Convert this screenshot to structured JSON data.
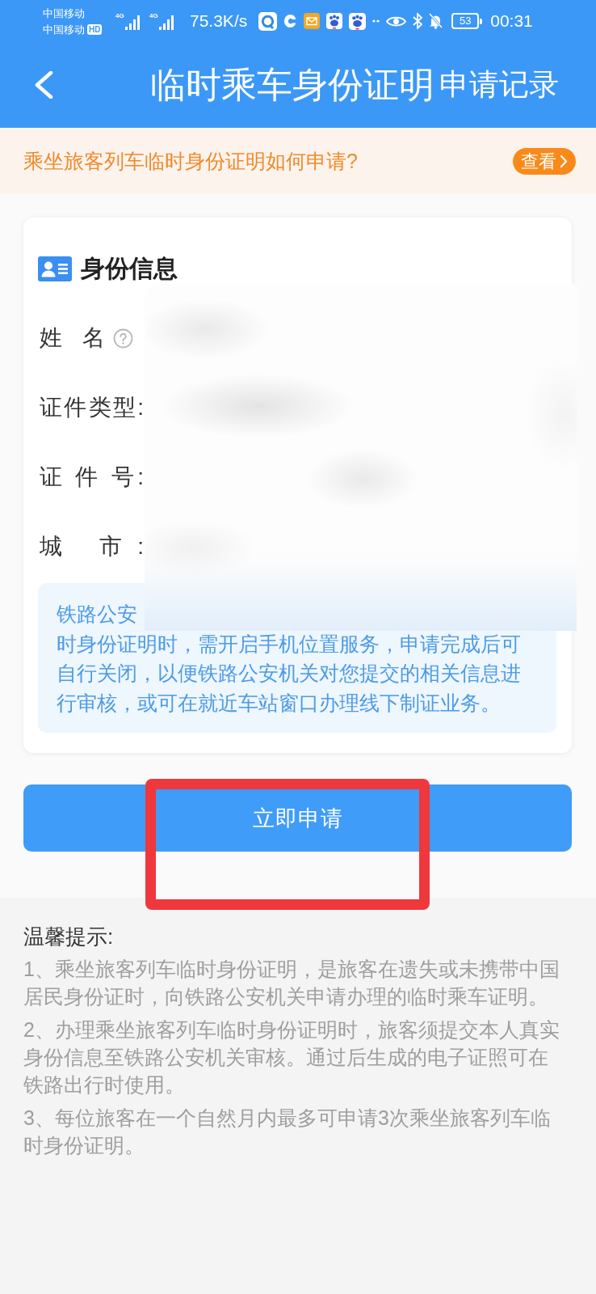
{
  "status_bar": {
    "carriers": [
      {
        "name": "中国移动"
      },
      {
        "name": "中国移动",
        "badge": "HD"
      }
    ],
    "signals": [
      {
        "network": "4G"
      },
      {
        "network": "4G"
      }
    ],
    "speed": "75.3K/s",
    "battery": "53",
    "time": "00:31"
  },
  "header": {
    "title": "临时乘车身份证明",
    "action": "申请记录"
  },
  "banner": {
    "text": "乘坐旅客列车临时身份证明如何申请?",
    "button": "查看"
  },
  "card": {
    "title": "身份信息",
    "fields": [
      {
        "label": "姓 名",
        "help": true
      },
      {
        "label": "证件类型:",
        "help": false
      },
      {
        "label": "证 件 号:",
        "help": false
      },
      {
        "label": "城 市:",
        "help": false
      }
    ],
    "notice": {
      "fragment": "铁路公安",
      "text": "时身份证明时，需开启手机位置服务，申请完成后可自行关闭，以便铁路公安机关对您提交的相关信息进行审核，或可在就近车站窗口办理线下制证业务。"
    }
  },
  "submit_button": "立即申请",
  "tips": {
    "title": "温馨提示:",
    "items": [
      "1、乘坐旅客列车临时身份证明，是旅客在遗失或未携带中国居民身份证时，向铁路公安机关申请办理的临时乘车证明。",
      "2、办理乘坐旅客列车临时身份证明时，旅客须提交本人真实身份信息至铁路公安机关审核。通过后生成的电子证照可在铁路出行时使用。",
      "3、每位旅客在一个自然月内最多可申请3次乘坐旅客列车临时身份证明。"
    ]
  }
}
